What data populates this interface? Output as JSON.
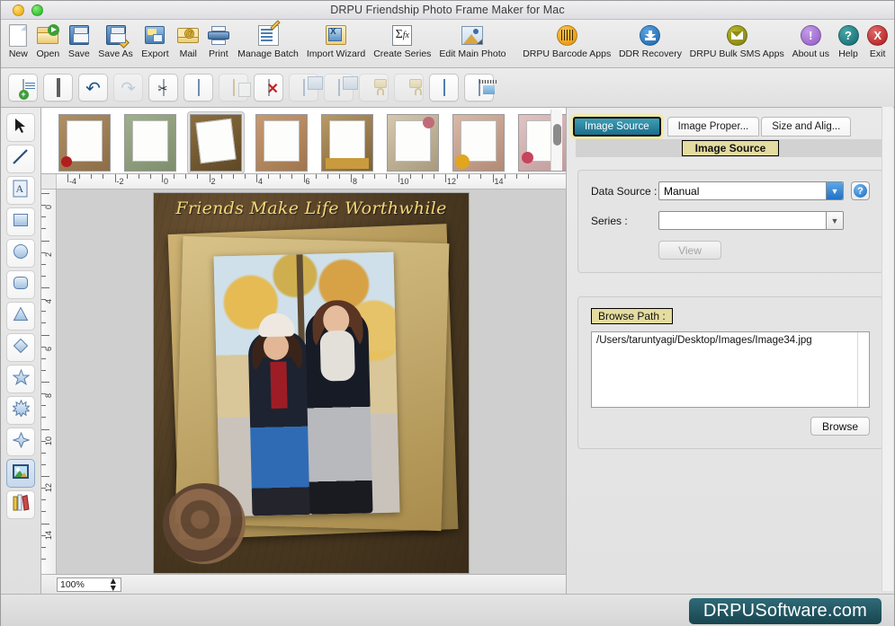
{
  "window": {
    "title": "DRPU Friendship Photo Frame Maker for Mac",
    "lights": [
      "minimize",
      "zoom"
    ]
  },
  "main_toolbar": [
    {
      "label": "New",
      "icon": "new-document-icon"
    },
    {
      "label": "Open",
      "icon": "open-folder-icon"
    },
    {
      "label": "Save",
      "icon": "save-disk-icon"
    },
    {
      "label": "Save As",
      "icon": "save-as-disk-icon"
    },
    {
      "label": "Export",
      "icon": "export-icon"
    },
    {
      "label": "Mail",
      "icon": "mail-envelope-icon"
    },
    {
      "label": "Print",
      "icon": "printer-icon"
    },
    {
      "label": "Manage Batch",
      "icon": "manage-batch-icon"
    },
    {
      "label": "Import Wizard",
      "icon": "import-wizard-icon"
    },
    {
      "label": "Create Series",
      "icon": "sigma-function-icon"
    },
    {
      "label": "Edit Main Photo",
      "icon": "edit-photo-icon"
    },
    {
      "label": "DRPU Barcode Apps",
      "icon": "barcode-circle-icon"
    },
    {
      "label": "DDR Recovery",
      "icon": "recovery-download-icon"
    },
    {
      "label": "DRPU Bulk SMS Apps",
      "icon": "sms-envelope-icon"
    },
    {
      "label": "About us",
      "icon": "about-exclamation-icon"
    },
    {
      "label": "Help",
      "icon": "help-question-icon"
    },
    {
      "label": "Exit",
      "icon": "exit-x-icon"
    }
  ],
  "sub_toolbar": [
    {
      "name": "add-page-button",
      "icon": "add-page-icon",
      "enabled": true
    },
    {
      "name": "select-frame-button",
      "icon": "frame-icon",
      "enabled": true
    },
    {
      "name": "undo-button",
      "icon": "undo-arrow-icon",
      "enabled": true
    },
    {
      "name": "redo-button",
      "icon": "redo-arrow-icon",
      "enabled": false
    },
    {
      "name": "cut-button",
      "icon": "scissors-cut-icon",
      "enabled": true
    },
    {
      "name": "copy-button",
      "icon": "copy-pages-icon",
      "enabled": true
    },
    {
      "name": "paste-button",
      "icon": "clipboard-paste-icon",
      "enabled": false
    },
    {
      "name": "delete-button",
      "icon": "delete-x-icon",
      "enabled": true
    },
    {
      "name": "group-button",
      "icon": "group-objects-icon",
      "enabled": false
    },
    {
      "name": "ungroup-button",
      "icon": "ungroup-objects-icon",
      "enabled": false
    },
    {
      "name": "lock-button",
      "icon": "lock-closed-icon",
      "enabled": false
    },
    {
      "name": "unlock-button",
      "icon": "lock-open-icon",
      "enabled": false
    },
    {
      "name": "grid-button",
      "icon": "grid-icon",
      "enabled": true
    },
    {
      "name": "ruler-button",
      "icon": "ruler-image-icon",
      "enabled": true
    }
  ],
  "tool_palette": [
    {
      "name": "select-tool",
      "icon": "cursor-arrow-icon",
      "active": false
    },
    {
      "name": "line-tool",
      "icon": "line-icon",
      "active": false
    },
    {
      "name": "text-tool",
      "icon": "text-a-icon",
      "active": false
    },
    {
      "name": "rectangle-tool",
      "icon": "rectangle-icon",
      "active": false
    },
    {
      "name": "ellipse-tool",
      "icon": "ellipse-icon",
      "active": false
    },
    {
      "name": "rounded-rectangle-tool",
      "icon": "rounded-rectangle-icon",
      "active": false
    },
    {
      "name": "triangle-tool",
      "icon": "triangle-icon",
      "active": false
    },
    {
      "name": "diamond-tool",
      "icon": "diamond-icon",
      "active": false
    },
    {
      "name": "star-tool",
      "icon": "star-icon",
      "active": false
    },
    {
      "name": "burst-tool",
      "icon": "burst-star-icon",
      "active": false
    },
    {
      "name": "four-point-star-tool",
      "icon": "four-point-star-icon",
      "active": false
    },
    {
      "name": "picture-tool",
      "icon": "picture-icon",
      "active": true
    },
    {
      "name": "barcode-tool",
      "icon": "barcode-books-icon",
      "active": false
    }
  ],
  "thumbnails": {
    "selected_index": 2,
    "count_row1": 8,
    "count_row2": 8
  },
  "rulers": {
    "horizontal_labels": [
      "-4",
      "-2",
      "0",
      "2",
      "4",
      "6",
      "8",
      "10",
      "12",
      "14"
    ],
    "vertical_labels": [
      "0",
      "2",
      "4",
      "6",
      "8",
      "10",
      "12",
      "14"
    ]
  },
  "canvas": {
    "headline": "Friends Make Life Worthwhile",
    "zoom": "100%"
  },
  "right_panel": {
    "tabs": [
      {
        "label": "Image Source",
        "active": true
      },
      {
        "label": "Image Proper...",
        "active": false
      },
      {
        "label": "Size and Alig...",
        "active": false
      }
    ],
    "section_title": "Image Source",
    "data_source": {
      "label": "Data Source :",
      "value": "Manual",
      "help_glyph": "?"
    },
    "series": {
      "label": "Series :",
      "value": ""
    },
    "view_button": "View",
    "browse_path": {
      "label": "Browse Path :",
      "value": "/Users/taruntyagi/Desktop/Images/Image34.jpg",
      "browse_button": "Browse"
    }
  },
  "footer": {
    "watermark": "DRPUSoftware.com"
  },
  "colors": {
    "accent_tab": "#1a6d8c",
    "tab_highlight": "#efe9a8",
    "pill_bg": "#e4dca0",
    "watermark_bg": "#17454f",
    "dropdown_arrow": "#1f71c7"
  }
}
